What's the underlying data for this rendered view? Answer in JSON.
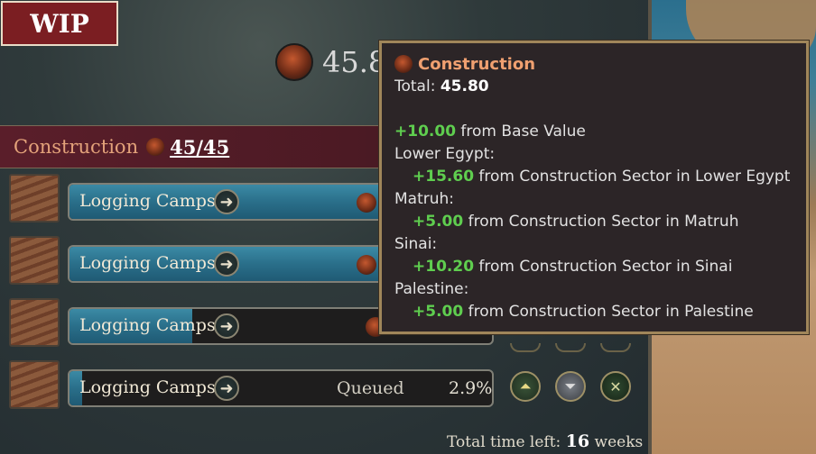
{
  "watermark": "WIP",
  "top_stat": {
    "value": "45.8",
    "icon": "construction-icon"
  },
  "panel": {
    "title": "Construction",
    "count": "45/45",
    "icon": "construction-icon"
  },
  "queue": [
    {
      "label": "Logging Camps",
      "status": "",
      "percent": "",
      "progress": 0.73
    },
    {
      "label": "Logging Camps",
      "status": "",
      "percent": "",
      "progress": 0.73
    },
    {
      "label": "Logging Camps",
      "status": "",
      "percent": "",
      "progress": 0.29
    },
    {
      "label": "Logging Camps",
      "status": "Queued",
      "percent": "2.9%",
      "progress": 0.029
    }
  ],
  "footer": {
    "prefix": "Total time left:",
    "value": "16",
    "unit": "weeks"
  },
  "tooltip": {
    "title": "Construction",
    "total_label": "Total:",
    "total_value": "45.80",
    "lines": [
      {
        "type": "mod",
        "indent": false,
        "value": "+10.00",
        "text": " from Base Value"
      },
      {
        "type": "header",
        "text": "Lower Egypt:"
      },
      {
        "type": "mod",
        "indent": true,
        "value": "+15.60",
        "text": " from Construction Sector in Lower Egypt"
      },
      {
        "type": "header",
        "text": "Matruh:"
      },
      {
        "type": "mod",
        "indent": true,
        "value": "+5.00",
        "text": " from Construction Sector in Matruh"
      },
      {
        "type": "header",
        "text": "Sinai:"
      },
      {
        "type": "mod",
        "indent": true,
        "value": "+10.20",
        "text": " from Construction Sector in Sinai"
      },
      {
        "type": "header",
        "text": "Palestine:"
      },
      {
        "type": "mod",
        "indent": true,
        "value": "+5.00",
        "text": " from Construction Sector in Palestine"
      }
    ]
  },
  "colors": {
    "accent": "#e3a27a",
    "positive": "#5fce4f",
    "header_bg": "#5a1e2a",
    "progress": "#2a6f8a"
  }
}
